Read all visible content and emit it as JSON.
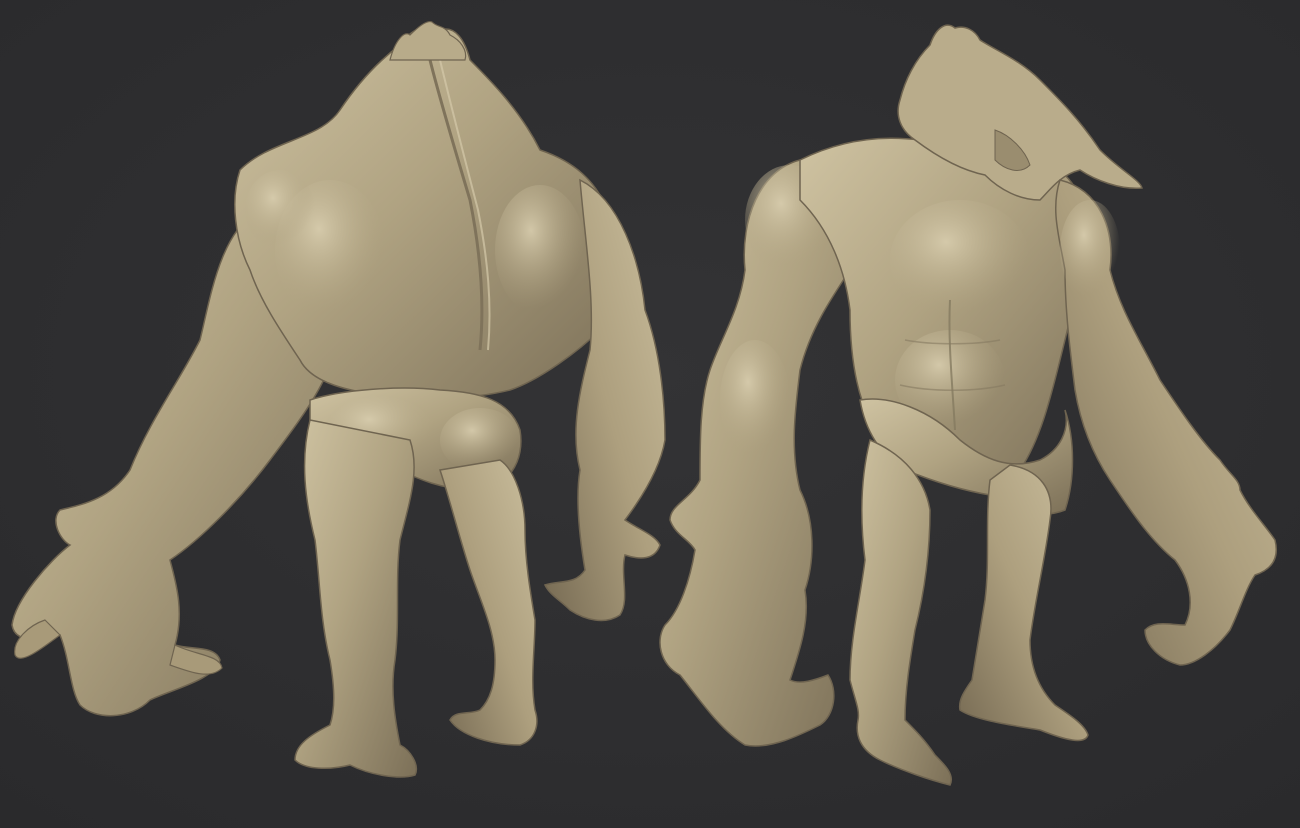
{
  "scene": {
    "background_color": "#2e2e30",
    "clay_color": "#b0a382",
    "clay_highlight": "#cfc3a2",
    "clay_shadow": "#6f6450",
    "views": [
      {
        "name": "back-view"
      },
      {
        "name": "front-view"
      }
    ]
  }
}
